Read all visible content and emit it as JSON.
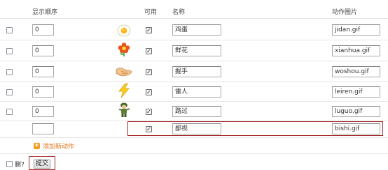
{
  "headers": {
    "order": "显示顺序",
    "enabled": "可用",
    "name": "名称",
    "image": "动作图片"
  },
  "rows": [
    {
      "order": "0",
      "name": "鸡蛋",
      "image": "jidan.gif",
      "icon": "egg-icon"
    },
    {
      "order": "0",
      "name": "鲜花",
      "image": "xianhua.gif",
      "icon": "flower-icon"
    },
    {
      "order": "0",
      "name": "握手",
      "image": "woshou.gif",
      "icon": "handshake-icon"
    },
    {
      "order": "0",
      "name": "雷人",
      "image": "leiren.gif",
      "icon": "lightning-icon"
    },
    {
      "order": "0",
      "name": "路过",
      "image": "luguo.gif",
      "icon": "soldier-icon"
    }
  ],
  "new_row": {
    "order": "",
    "name": "鄙视",
    "image": "bishi.gif"
  },
  "add_action_label": "添加新动作",
  "delete_label": "删?",
  "submit_label": "提交",
  "colors": {
    "highlight": "#a52a2a",
    "add_link": "#e0761e",
    "add_plus": "#f29b1d"
  }
}
